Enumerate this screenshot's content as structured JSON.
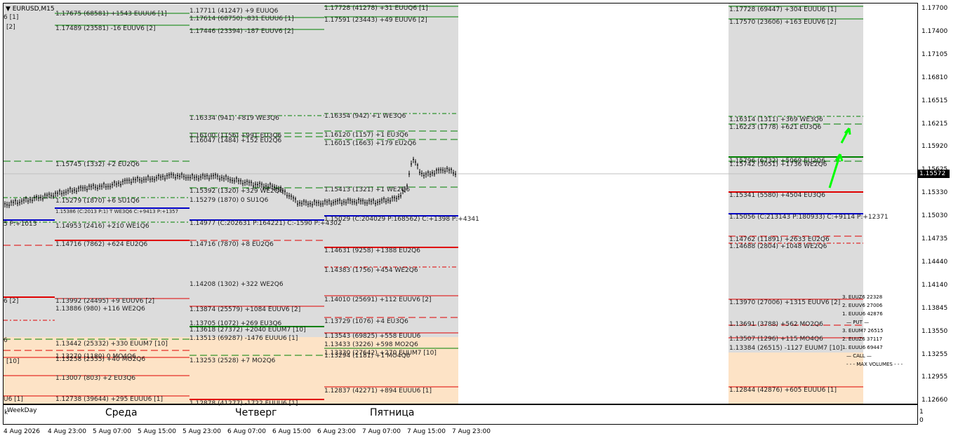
{
  "window": {
    "symbol_title": "EURUSD,M15"
  },
  "price_axis": {
    "ticks": [
      "1.17700",
      "1.17400",
      "1.17105",
      "1.16810",
      "1.16515",
      "1.16215",
      "1.15920",
      "1.15625",
      "1.15330",
      "1.15030",
      "1.14735",
      "1.14440",
      "1.14140",
      "1.13845",
      "1.13550",
      "1.13255",
      "1.12955",
      "1.12660"
    ],
    "current_price": "1.15572"
  },
  "time_axis": {
    "labels": [
      "4 Aug 2026",
      "4 Aug 23:00",
      "5 Aug 07:00",
      "5 Aug 15:00",
      "5 Aug 23:00",
      "6 Aug 07:00",
      "6 Aug 15:00",
      "6 Aug 23:00",
      "7 Aug 07:00",
      "7 Aug 15:00",
      "7 Aug 23:00"
    ]
  },
  "subwindow": {
    "indicator_name": "WeekDay",
    "marker": "k",
    "scale_top": "1",
    "scale_bottom": "0",
    "days": [
      "Среда",
      "Четверг",
      "Пятница"
    ]
  },
  "colors": {
    "zone_grey": "#dcdcdc",
    "zone_orange": "#fde3c6",
    "line_green": "#008000",
    "line_red": "#e00000",
    "line_blue": "#0000c8",
    "arrow_green": "#00ff00"
  },
  "levels": [
    "1.17711 (41247) +9 EUUQ6",
    "1.17614 (68750) -831 EUUU6 [1]",
    "1.17446 (23394) -187 EUUV6 [2]",
    "1.17728 (41278) +31 EUUQ6 [1]",
    "1.17591 (23443) +49 EUUV6 [2]",
    "1.17728 (69447) +304 EUUU6 [1]",
    "1.17570 (23606) +163 EUUV6 [2]",
    "1.17675 (68581) +1543 EUUU6 [1]",
    "1.17489 (23581) -16 EUUV6 [2]",
    "1.16334 (941) +819 WE3Q6",
    "1.16100 (1156) +991 EU3Q6",
    "1.16047 (1484) +152 EU2Q6",
    "1.16354 (942) +1 WE3Q6",
    "1.16120 (1157) +1 EU3Q6",
    "1.16015 (1663) +179 EU2Q6",
    "1.16314 (1311) +369 WE3Q6",
    "1.16223 (1778) +621 EU3Q6",
    "1.15745 (1332) +2 EU2Q6",
    "1.15796 (6732) +5069 EU2Q6",
    "1.15742 (3051) +1736 WE2Q6",
    "1.15392 (1320) +329 WE2Q6",
    "1.15279 (1870) 0 SU1Q6",
    "1.15413 (1321) +1 WE2Q6",
    "1.15279 (1870) +6 SU1Q6",
    "1.15341 (5580) +4504 EU3Q6",
    "1.14977 (C:202631 P:164221) C:-1590 P:+4302",
    "1.15029 (C:204029 P:168562) C:+1398 P:+4341",
    "1.15056 (C:213143 P:180933) C:+9114 P:+12371",
    "1.14953 (2416) +210 WE1Q6",
    "1.14716 (7862) +624 EU2Q6",
    "1.14716 (7870) +8 EU2Q6",
    "1.14631 (9258) +1388 EU2Q6",
    "1.14762 (11891) +2633 EU2Q6",
    "1.14688 (2804) +1048 WE2Q6",
    "1.14383 (1756) +454 WE2Q6",
    "1.14208 (1302) +322 WE2Q6",
    "1.13992 (24495) +9 EUUV6 [2]",
    "1.13886 (980) +116 WE2Q6",
    "1.13874 (25579) +1084 EUUV6 [2]",
    "1.14010 (25691) +112 EUUV6 [2]",
    "1.13970 (27006) +1315 EUUV6 [2]",
    "1.13729 (1076) +4 EU3Q6",
    "1.13705 (1072) +269 EU3Q6",
    "1.13618 (27372) +2040 EUUM7 [10]",
    "1.13691 (3788) +562 MO2Q6",
    "1.13513 (69287) -1476 EUUU6 [1]",
    "1.13442 (25332) +330 EUUM7 [10]",
    "1.13543 (69825) +558 EUUU6",
    "1.13433 (3226) +598 MO2Q6",
    "1.13330 (27642) +270 EUUM7 [10]",
    "1.13294 (1181) +1 MO4Q6",
    "1.13507 (1296) +115 MO4Q6",
    "1.13384 (26515) -1127 EUUM7 [10]",
    "1.13270 (1180) 0 MO4Q6",
    "1.13253 (2528) +7 MO2Q6",
    "1.13258 (2555) +40 MO2Q6",
    "1.13007 (803) +2 EU3Q6",
    "1.12738 (39644) +295 EUUU6 [1]",
    "1.12837 (42271) +894 EUUU6 [1]",
    "1.12844 (42876) +605 EUUU6 [1]",
    "1.12878 (41277) -1722 EUUU6 [1]"
  ],
  "fragments": [
    "6 [1]",
    "[2]",
    "5 P:+1013",
    "6 [2]",
    "6",
    "[10]",
    "U6 [1]",
    "1.15386 (C:2013 P:1) T WE3Q6 C:+9413 P:+1357"
  ],
  "legend": [
    "3. EUUZ6 22328",
    "2. EUUV6 27006",
    "1. EUUU6 42876",
    "— PUT —",
    "3. EUUM7 26515",
    "2. EUUZ6 37117",
    "1. EUUU6 69447",
    "— CALL —",
    "MAX VOLUMES"
  ]
}
